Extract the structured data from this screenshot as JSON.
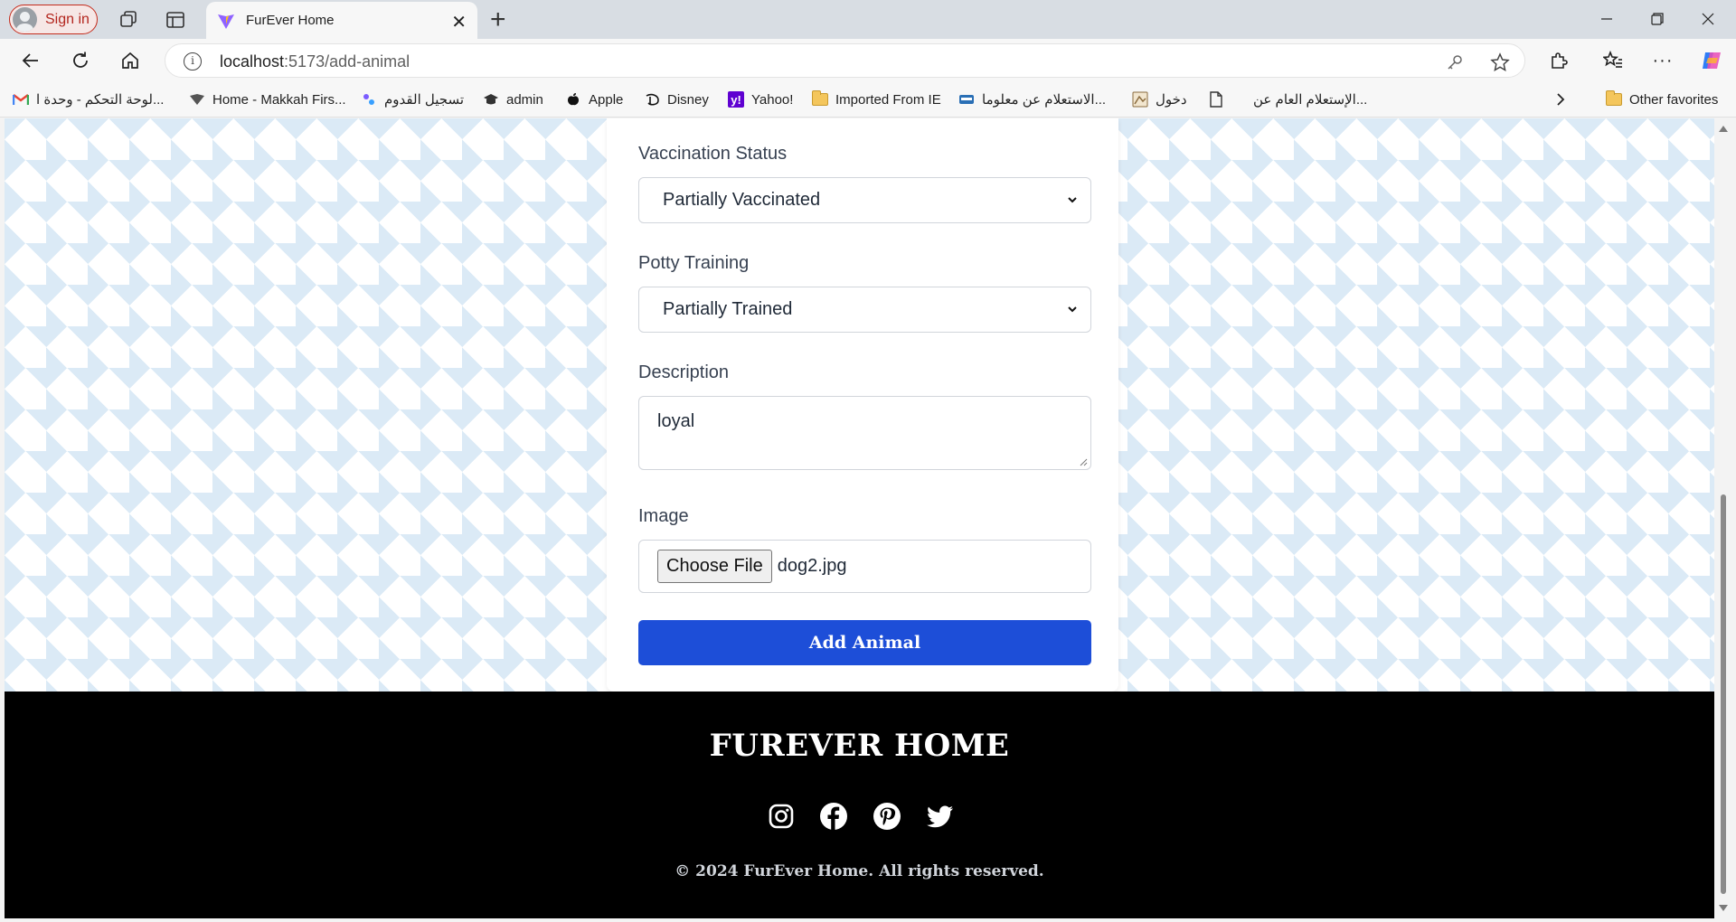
{
  "browser": {
    "signin_label": "Sign in",
    "tab_title": "FurEver Home",
    "url_host": "localhost",
    "url_path": ":5173/add-animal"
  },
  "bookmarks": [
    {
      "label": "لوحة التحكم - وحدة ا...",
      "icon": "gmail-icon"
    },
    {
      "label": "Home - Makkah Firs...",
      "icon": "bookmark-site-icon"
    },
    {
      "label": "تسجيل القدوم",
      "icon": "bookmark-site-icon"
    },
    {
      "label": "admin",
      "icon": "graduation-cap-icon"
    },
    {
      "label": "Apple",
      "icon": "apple-icon"
    },
    {
      "label": "Disney",
      "icon": "disney-icon"
    },
    {
      "label": "Yahoo!",
      "icon": "yahoo-icon"
    },
    {
      "label": "Imported From IE",
      "icon": "folder-icon"
    },
    {
      "label": "الاستعلام عن معلوما...",
      "icon": "bookmark-site-icon"
    },
    {
      "label": "دخول",
      "icon": "bookmark-site-icon"
    },
    {
      "label": "الإستعلام العام عن...",
      "icon": "page-icon"
    }
  ],
  "other_favorites": "Other favorites",
  "form": {
    "vaccination_label": "Vaccination Status",
    "vaccination_value": "Partially Vaccinated",
    "potty_label": "Potty Training",
    "potty_value": "Partially Trained",
    "description_label": "Description",
    "description_value": "loyal",
    "image_label": "Image",
    "choose_file_label": "Choose File",
    "file_name": "dog2.jpg",
    "submit_label": "Add Animal"
  },
  "footer": {
    "brand": "FUREVER HOME",
    "socials": [
      "instagram-icon",
      "facebook-icon",
      "pinterest-icon",
      "twitter-icon"
    ],
    "copyright": "© 2024 FurEver Home. All rights reserved."
  },
  "colors": {
    "primary_button": "#1d4ed8",
    "footer_bg": "#000000",
    "pattern": "#dbeaf6"
  }
}
